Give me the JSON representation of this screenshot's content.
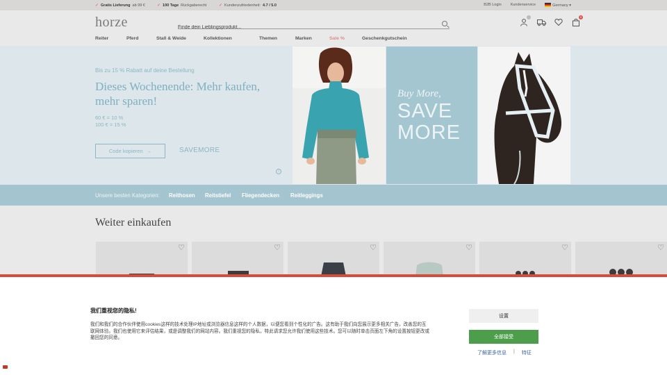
{
  "topbar": {
    "usp": [
      {
        "bold": "Gratis Lieferung",
        "rest": "ab 99 €"
      },
      {
        "bold": "100 Tage",
        "rest": "Rückgaberecht"
      },
      {
        "bold": "4.7 / 5.0",
        "pre": "Kundenzufriedenheit:"
      }
    ],
    "b2b_login": "B2B Login",
    "customer_service": "Kundenservice",
    "country": "Germany"
  },
  "header": {
    "logo": "horze",
    "search_placeholder": "Finde dein Lieblingsprodukt...",
    "icons": [
      "user-icon",
      "truck-icon",
      "heart-icon",
      "bag-icon"
    ],
    "user_badge": "",
    "cart_badge": "0"
  },
  "nav": [
    "Reiter",
    "Pferd",
    "Stall & Weide",
    "Kollektionen",
    "Themen",
    "Marken",
    "Sale %",
    "Geschenkgutschein"
  ],
  "hero": {
    "subtitle": "Bis zu 15 % Rabatt auf deine Bestellung",
    "title": "Dieses Wochenende: Mehr kaufen, mehr sparen!",
    "tier1": "60 € = 10 %",
    "tier2": "100 € = 15 %",
    "code_button": "Code kopieren",
    "code": "SAVEMORE",
    "banner_buy": "Buy More,",
    "banner_save": "SAVE",
    "banner_more": "MORE"
  },
  "categories": {
    "label": "Unsere besten Kategorien:",
    "items": [
      "Reithosen",
      "Reitstiefel",
      "Fliegendecken",
      "Reitleggings"
    ]
  },
  "section_title": "Weiter einkaufen",
  "cookie": {
    "title": "我们重视您的隐私!",
    "text": "我们和我们的合作伙伴使用cookies这样的技术处理IP地址或浏览器信息这样的个人数据，以便您看到个性化的广告。这有助于我们向您展示更多相关广告，改善您的互联网体验。我们也使用它来评估结果，或是调整我们的网站内容。我们重视您的隐私，特此请求您允许我们使用这些技术。您可以随时单击页面左下角的设置按钮更改或撤回您的同意。",
    "settings_button": "设置",
    "accept_button": "全部接受",
    "more_info": "了解更多信息",
    "separator": "|",
    "features": "特征"
  },
  "colors": {
    "accent": "#7fb0c0",
    "category_band": "#a4c5cf",
    "accept": "#4d9e4b",
    "cookie_border": "#d84a3c"
  }
}
